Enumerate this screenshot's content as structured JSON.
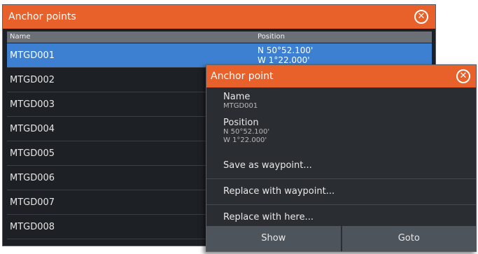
{
  "main": {
    "title": "Anchor points",
    "close_glyph": "✕",
    "columns": {
      "name": "Name",
      "position": "Position"
    },
    "rows": [
      {
        "name": "MTGD001",
        "lat": "N  50°52.100'",
        "lon": "W    1°22.000'"
      },
      {
        "name": "MTGD002"
      },
      {
        "name": "MTGD003"
      },
      {
        "name": "MTGD004"
      },
      {
        "name": "MTGD005"
      },
      {
        "name": "MTGD006"
      },
      {
        "name": "MTGD007"
      },
      {
        "name": "MTGD008"
      }
    ]
  },
  "dialog": {
    "title": "Anchor point",
    "close_glyph": "✕",
    "name_label": "Name",
    "name_value": "MTGD001",
    "position_label": "Position",
    "lat": "N  50°52.100'",
    "lon": "W   1°22.000'",
    "actions": [
      "Save as waypoint...",
      "Replace with waypoint...",
      "Replace with here..."
    ],
    "buttons": {
      "show": "Show",
      "goto": "Goto"
    }
  },
  "colors": {
    "accent": "#e8602a",
    "selection": "#3d7fd0",
    "panel": "#1d2024"
  }
}
